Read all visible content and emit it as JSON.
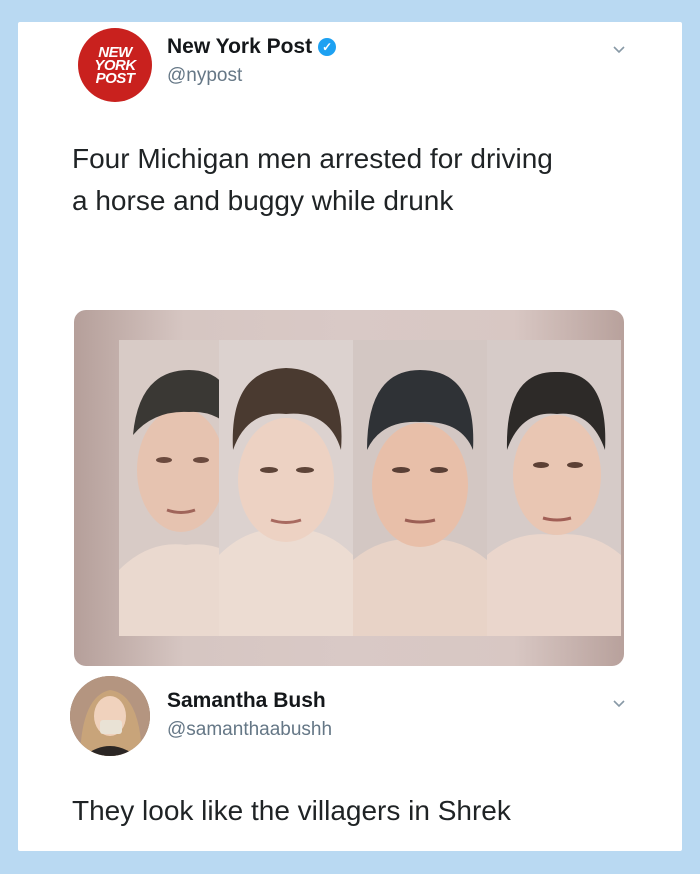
{
  "tweet": {
    "author_name": "New York Post",
    "author_handle": "@nypost",
    "logo_text": [
      "NEW",
      "YORK",
      "POST"
    ],
    "text_line1": "Four Michigan men arrested for driving",
    "text_line2": "a horse and buggy while drunk"
  },
  "reply": {
    "author_name": "Samantha Bush",
    "author_handle": "@samanthaabushh",
    "text": "They look like the villagers in Shrek"
  },
  "colors": {
    "background": "#b9d9f2",
    "logo_red": "#c9211e",
    "verified_blue": "#1da1f2",
    "handle_gray": "#657786"
  },
  "icons": [
    "verified-badge-icon",
    "chevron-down-icon"
  ]
}
